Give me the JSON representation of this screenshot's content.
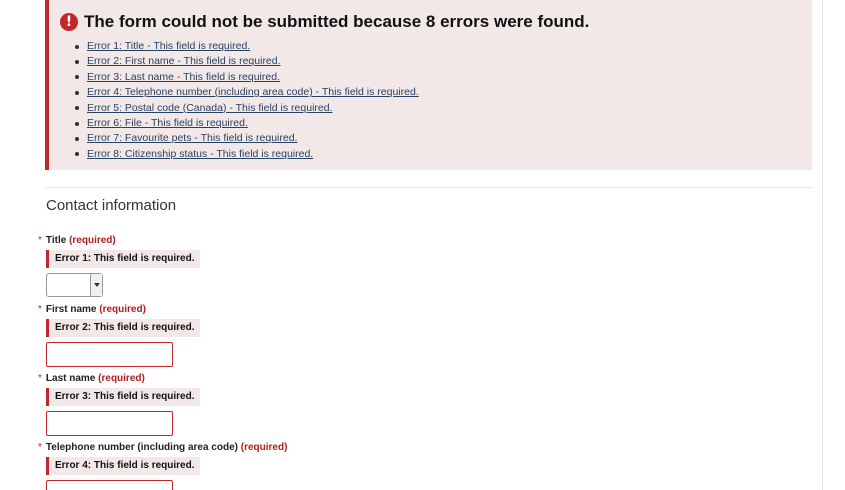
{
  "error_summary": {
    "heading": "The form could not be submitted because 8 errors were found.",
    "icon": "exclamation-icon",
    "accent_color": "#c1272d",
    "errors": [
      "Error 1: Title - This field is required.",
      "Error 2: First name - This field is required.",
      "Error 3: Last name - This field is required.",
      "Error 4: Telephone number (including area code) - This field is required.",
      "Error 5: Postal code (Canada) - This field is required.",
      "Error 6: File - This field is required.",
      "Error 7: Favourite pets - This field is required.",
      "Error 8: Citizenship status - This field is required."
    ]
  },
  "section": {
    "heading": "Contact information"
  },
  "fields": [
    {
      "asterisk": "*",
      "label": "Title",
      "required": "(required)",
      "error": "Error 1: This field is required.",
      "type": "select",
      "value": ""
    },
    {
      "asterisk": "*",
      "label": "First name",
      "required": "(required)",
      "error": "Error 2: This field is required.",
      "type": "text",
      "value": ""
    },
    {
      "asterisk": "*",
      "label": "Last name",
      "required": "(required)",
      "error": "Error 3: This field is required.",
      "type": "text",
      "value": ""
    },
    {
      "asterisk": "*",
      "label": "Telephone number (including area code)",
      "required": "(required)",
      "error": "Error 4: This field is required.",
      "type": "text",
      "value": ""
    }
  ]
}
